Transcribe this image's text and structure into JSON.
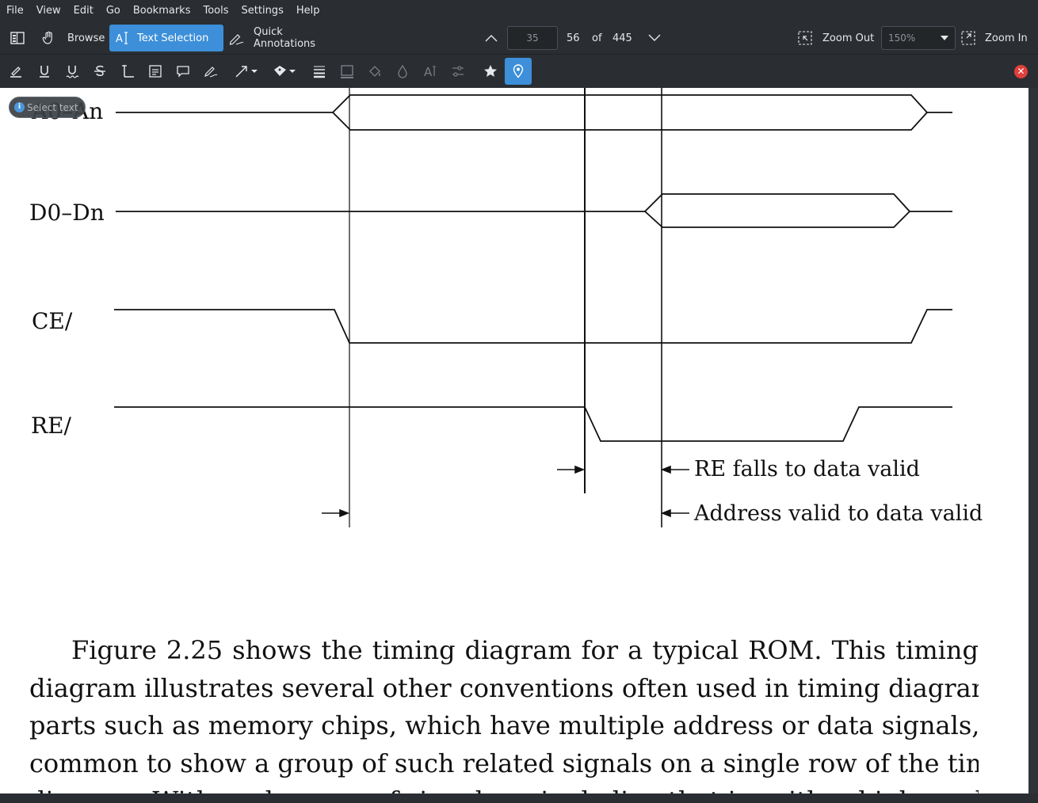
{
  "menubar": {
    "items": [
      "File",
      "View",
      "Edit",
      "Go",
      "Bookmarks",
      "Tools",
      "Settings",
      "Help"
    ]
  },
  "toolbar": {
    "browse_label": "Browse",
    "text_selection_label": "Text Selection",
    "quick_annotations_label": "Quick Annotations",
    "page_input_value": "35",
    "current_page": "56",
    "of_label": "of",
    "total_pages": "445",
    "zoom_out_label": "Zoom Out",
    "zoom_value": "150%",
    "zoom_in_label": "Zoom In"
  },
  "tooltip": {
    "text": "Select text"
  },
  "diagram": {
    "signals": [
      "A0–An",
      "D0–Dn",
      "CE/",
      "RE/"
    ],
    "annotations": [
      "RE falls to data valid",
      "Address valid to data valid"
    ]
  },
  "paragraph": {
    "lines": [
      "Figure 2.25 shows the timing diagram for a typical ROM. This timing",
      "diagram illustrates several other conventions often used in timing diagrams. With",
      "parts such as memory chips, which have multiple address or data signals, it is",
      "common to show a group of such related signals on a single row of the timing",
      "diagram. With each group of signals a single line that is neither high nor low"
    ]
  },
  "colors": {
    "accent": "#3d8fd9",
    "chrome": "#2a2e32",
    "close": "#e0403c"
  }
}
